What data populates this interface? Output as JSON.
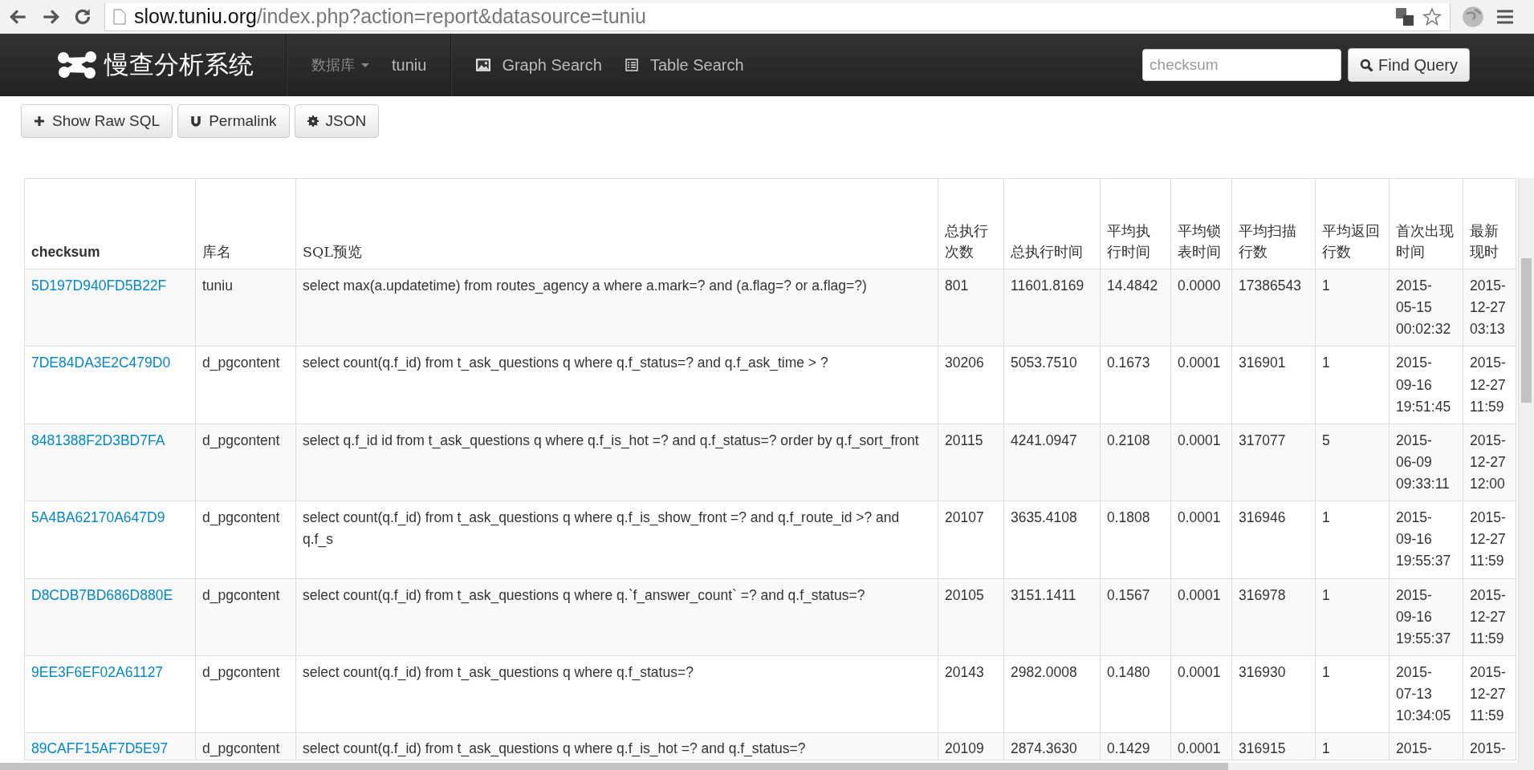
{
  "browser": {
    "url_host": "slow.tuniu.org",
    "url_path": "/index.php?action=report&datasource=tuniu"
  },
  "navbar": {
    "brand": "慢查分析系统",
    "db_label": "数据库",
    "db_value": "tuniu",
    "links": [
      {
        "kind": "image",
        "label": "Graph Search"
      },
      {
        "kind": "list",
        "label": "Table Search"
      }
    ],
    "search": {
      "placeholder": "checksum"
    },
    "find_button": "Find Query"
  },
  "actions": [
    {
      "kind": "plus",
      "label": "Show Raw SQL"
    },
    {
      "kind": "magnet",
      "label": "Permalink"
    },
    {
      "kind": "gear",
      "label": "JSON"
    }
  ],
  "table": {
    "columns": [
      "checksum",
      "库名",
      "SQL预览",
      "总执行次数",
      "总执行时间",
      "平均执行时间",
      "平均锁表时间",
      "平均扫描行数",
      "平均返回行数",
      "首次出现时间",
      "最新现时"
    ],
    "rows": [
      {
        "checksum": "5D197D940FD5B22F",
        "db": "tuniu",
        "sql": "select max(a.updatetime) from routes_agency a where a.mark=? and (a.flag=? or a.flag=?)",
        "count": "801",
        "total": "11601.8169",
        "avg_exec": "14.4842",
        "avg_lock": "0.0000",
        "avg_scan": "17386543",
        "avg_ret": "1",
        "first": "2015-05-15 00:02:32",
        "last": "2015-12-27 03:13"
      },
      {
        "checksum": "7DE84DA3E2C479D0",
        "db": "d_pgcontent",
        "sql": "select count(q.f_id) from t_ask_questions q where q.f_status=? and q.f_ask_time > ?",
        "count": "30206",
        "total": "5053.7510",
        "avg_exec": "0.1673",
        "avg_lock": "0.0001",
        "avg_scan": "316901",
        "avg_ret": "1",
        "first": "2015-09-16 19:51:45",
        "last": "2015-12-27 11:59"
      },
      {
        "checksum": "8481388F2D3BD7FA",
        "db": "d_pgcontent",
        "sql": "select q.f_id id from t_ask_questions q where q.f_is_hot =? and q.f_status=? order by q.f_sort_front",
        "count": "20115",
        "total": "4241.0947",
        "avg_exec": "0.2108",
        "avg_lock": "0.0001",
        "avg_scan": "317077",
        "avg_ret": "5",
        "first": "2015-06-09 09:33:11",
        "last": "2015-12-27 12:00"
      },
      {
        "checksum": "5A4BA62170A647D9",
        "db": "d_pgcontent",
        "sql": "select count(q.f_id) from t_ask_questions q where q.f_is_show_front =? and q.f_route_id >? and q.f_s",
        "count": "20107",
        "total": "3635.4108",
        "avg_exec": "0.1808",
        "avg_lock": "0.0001",
        "avg_scan": "316946",
        "avg_ret": "1",
        "first": "2015-09-16 19:55:37",
        "last": "2015-12-27 11:59"
      },
      {
        "checksum": "D8CDB7BD686D880E",
        "db": "d_pgcontent",
        "sql": "select count(q.f_id) from t_ask_questions q where q.`f_answer_count` =? and q.f_status=?",
        "count": "20105",
        "total": "3151.1411",
        "avg_exec": "0.1567",
        "avg_lock": "0.0001",
        "avg_scan": "316978",
        "avg_ret": "1",
        "first": "2015-09-16 19:55:37",
        "last": "2015-12-27 11:59"
      },
      {
        "checksum": "9EE3F6EF02A61127",
        "db": "d_pgcontent",
        "sql": "select count(q.f_id) from t_ask_questions q where q.f_status=?",
        "count": "20143",
        "total": "2982.0008",
        "avg_exec": "0.1480",
        "avg_lock": "0.0001",
        "avg_scan": "316930",
        "avg_ret": "1",
        "first": "2015-07-13 10:34:05",
        "last": "2015-12-27 11:59"
      },
      {
        "checksum": "89CAFF15AF7D5E97",
        "db": "d_pgcontent",
        "sql": "select count(q.f_id) from t_ask_questions q where q.f_is_hot =? and q.f_status=?",
        "count": "20109",
        "total": "2874.3630",
        "avg_exec": "0.1429",
        "avg_lock": "0.0001",
        "avg_scan": "316915",
        "avg_ret": "1",
        "first": "2015-",
        "last": "2015-"
      }
    ]
  }
}
